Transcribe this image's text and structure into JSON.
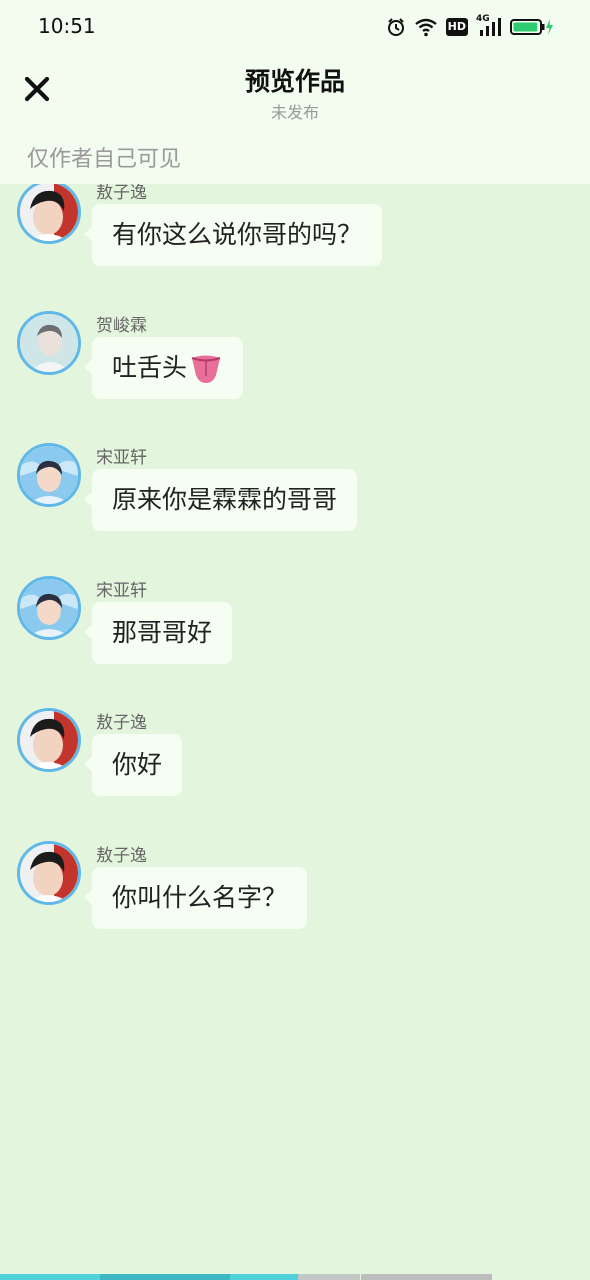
{
  "status": {
    "time": "10:51",
    "network": "4G",
    "hd": "HD",
    "battery_level": 0.95,
    "battery_color": "#2ecc71"
  },
  "header": {
    "title": "预览作品",
    "subtitle": "未发布",
    "visibility_note": "仅作者自己可见",
    "close_icon": "close-icon"
  },
  "messages": [
    {
      "sender": "敖子逸",
      "text": "有你这么说你哥的吗？"
    },
    {
      "sender": "贺峻霖",
      "text": "吐舌头",
      "emoji": "tongue-emoji"
    },
    {
      "sender": "宋亚轩",
      "text": "原来你是霖霖的哥哥"
    },
    {
      "sender": "宋亚轩",
      "text": "那哥哥好"
    },
    {
      "sender": "敖子逸",
      "text": "你好"
    },
    {
      "sender": "敖子逸",
      "text": "你叫什么名字？"
    }
  ],
  "colors": {
    "background": "#e4f5dd",
    "header_background": "#f2fcef",
    "bubble": "#f6fdf3",
    "avatar_ring": "#5fb8e8",
    "progress_active": "#4fd1d9",
    "progress_inactive": "#bdbdbd"
  }
}
